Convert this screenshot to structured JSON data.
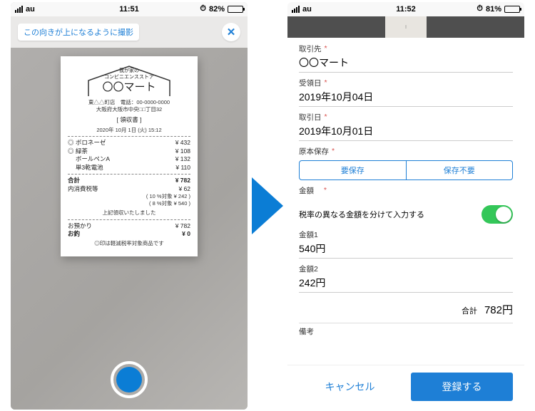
{
  "status_left": {
    "carrier": "au",
    "time": "11:51",
    "alarm": "⏱",
    "batt": "82%"
  },
  "status_right": {
    "carrier": "au",
    "time": "11:52",
    "alarm": "⏱",
    "batt": "81%"
  },
  "camera": {
    "hint": "この向きが上になるように撮影",
    "close_glyph": "✕"
  },
  "receipt": {
    "tagline1": "我が家の",
    "tagline2": "コンビニエンスストア",
    "store": "〇〇マート",
    "branch": "東△△町店　電話：00-0000-0000",
    "addr": "大阪府大阪市中央□□丁目32",
    "title": "[ 領収書 ]",
    "datetime": "2020年 10月 1日 (火)  15:12",
    "items": [
      {
        "mark": "◎",
        "name": "ボロネーゼ",
        "price": "¥ 432"
      },
      {
        "mark": "◎",
        "name": "緑茶",
        "price": "¥ 108"
      },
      {
        "mark": "",
        "name": "ボールペンA",
        "price": "¥ 132"
      },
      {
        "mark": "",
        "name": "単3乾電池",
        "price": "¥ 110"
      }
    ],
    "total_lbl": "合計",
    "total": "¥ 782",
    "tax_lbl": "内消費税等",
    "tax": "¥ 62",
    "breakdown1": "( 10 %対象 ¥ 242 )",
    "breakdown2": "(  8 %対象 ¥ 540 )",
    "thanks": "上記領収いたしました",
    "deposit_lbl": "お預かり",
    "deposit": "¥ 782",
    "change_lbl": "お釣",
    "change": "¥ 0",
    "note": "◎印は軽減税率対象商品です"
  },
  "form": {
    "vendor": {
      "label": "取引先",
      "value": "〇〇マート"
    },
    "received": {
      "label": "受領日",
      "value": "2019年10月04日"
    },
    "txn": {
      "label": "取引日",
      "value": "2019年10月01日"
    },
    "original": {
      "label": "原本保存"
    },
    "seg": {
      "keep": "要保存",
      "discard": "保存不要"
    },
    "amount_label": "金額",
    "split_label": "税率の異なる金額を分けて入力する",
    "amount1": {
      "label": "金額1",
      "value": "540円"
    },
    "amount2": {
      "label": "金額2",
      "value": "242円"
    },
    "total_label": "合計",
    "total_value": "782円",
    "memo_label": "備考",
    "cancel": "キャンセル",
    "submit": "登録する",
    "req": "*"
  }
}
